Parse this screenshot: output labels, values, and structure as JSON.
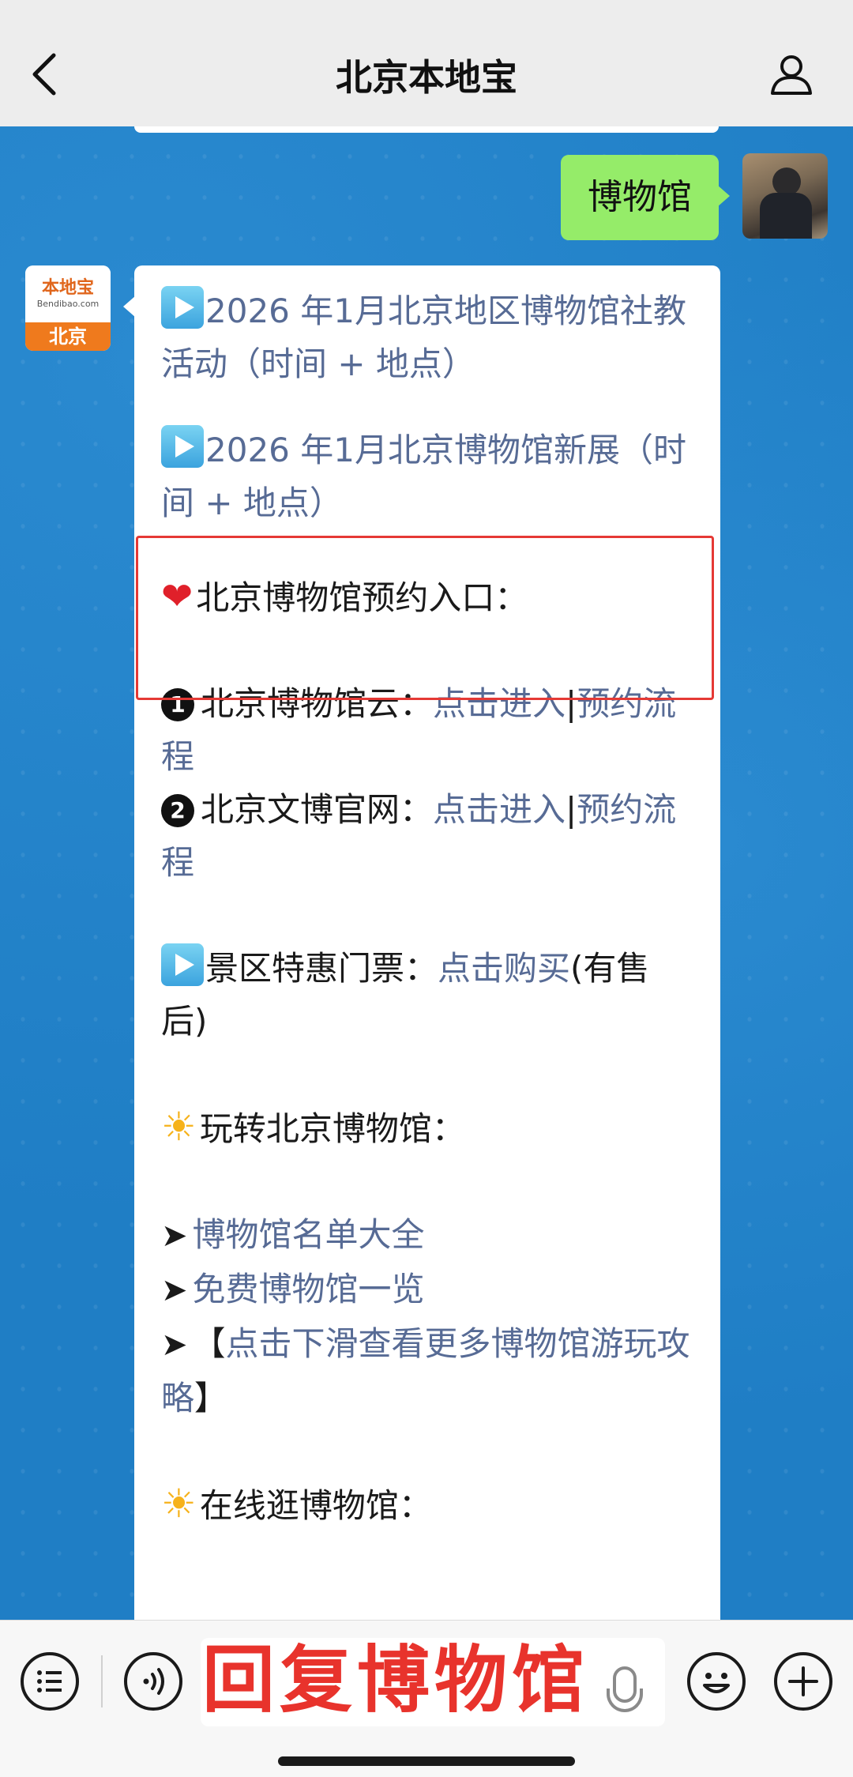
{
  "header": {
    "title": "北京本地宝",
    "back_icon": "chevron-left-icon",
    "profile_icon": "user-icon"
  },
  "chat": {
    "my_message": "博物馆",
    "bot_avatar": {
      "brand": "本地宝",
      "url": "Bendibao.com",
      "city": "北京"
    },
    "bot_message": {
      "item1": "2026 年1月北京地区博物馆社教活动（时间 + 地点）",
      "item2": "2026 年1月北京博物馆新展（时间 + 地点）",
      "reserve_heading": "北京博物馆预约入口：",
      "reserve": [
        {
          "num": "1",
          "label": "北京博物馆云：",
          "link1": "点击进入",
          "sep": "|",
          "link2": "预约流程"
        },
        {
          "num": "2",
          "label": "北京文博官网：",
          "link1": "点击进入",
          "sep": "|",
          "link2": "预约流程"
        }
      ],
      "tickets_label": "景区特惠门票：",
      "tickets_link": "点击购买",
      "tickets_note": "(有售后)",
      "play_heading": "玩转北京博物馆：",
      "play_links": [
        "博物馆名单大全",
        "免费博物馆一览"
      ],
      "more_open": "【",
      "more_link": "点击下滑查看更多博物馆游玩攻略",
      "more_close": "】",
      "online_heading": "在线逛博物馆："
    }
  },
  "bottom": {
    "overlay_text": "回复博物馆",
    "icons": [
      "menu-icon",
      "voice-icon",
      "mic-icon",
      "emoji-icon",
      "plus-icon"
    ]
  },
  "colors": {
    "link": "#576b95",
    "my_bubble": "#95ec69",
    "highlight_border": "#e53935",
    "overlay_text": "#e8332c"
  }
}
